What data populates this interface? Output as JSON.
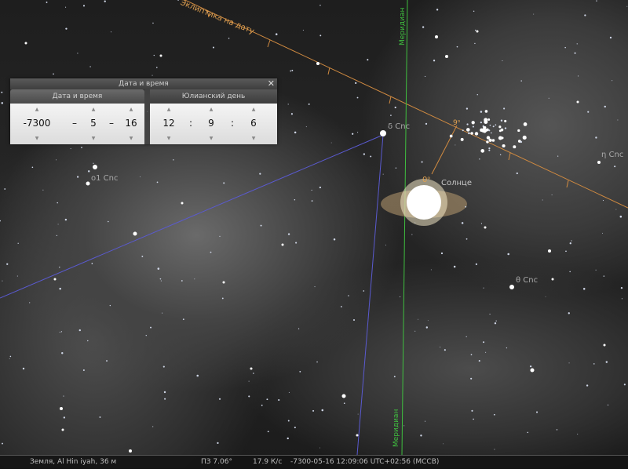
{
  "sky": {
    "ecliptic_label": "Эклиптика на дату",
    "meridian_label": "Меридиан",
    "stars": {
      "delta_cnc": "δ Cnc",
      "omicron1_cnc": "o1 Cnc",
      "eta_cnc": "η Cnc",
      "theta_cnc": "θ Cnc"
    },
    "sun_label": "Солнце",
    "sun_marker": "0ᵒ",
    "cluster_marker": "9ᵒ"
  },
  "dialog": {
    "title": "Дата и время",
    "close_glyph": "✕",
    "tabs": {
      "date_time": "Дата и время",
      "julian_day": "Юлианский день"
    },
    "date": {
      "year": "-7300",
      "sep1": "–",
      "month": "5",
      "sep2": "–",
      "day": "16"
    },
    "time": {
      "hour": "12",
      "sep1": ":",
      "minute": "9",
      "sep2": ":",
      "second": "6"
    },
    "spin_up_glyph": "▲",
    "spin_down_glyph": "▼"
  },
  "status_bar": {
    "location": "Земля, Al Hin  iyah, 36 м",
    "fov": "ПЗ 7.06°",
    "fps": "17.9 К/с",
    "datetime": "-7300-05-16 12:09:06 UTC+02:56 (МССВ)"
  },
  "colors": {
    "ecliptic": "#e0a050",
    "meridian": "#3fbf3f",
    "equator": "#5a5ad0"
  }
}
